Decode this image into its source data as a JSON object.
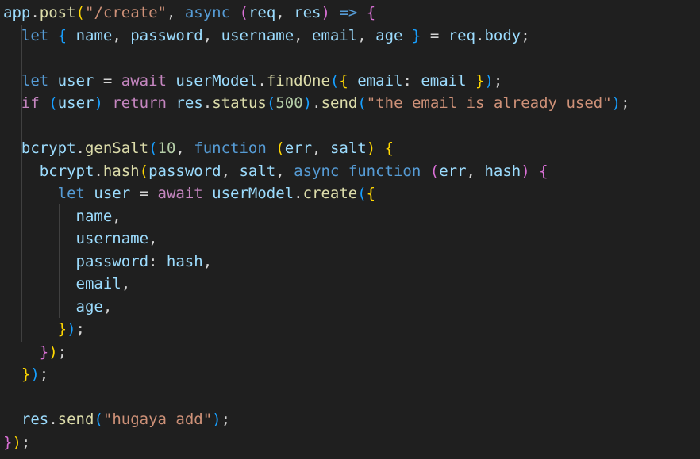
{
  "editor": {
    "theme": {
      "background": "#1f1f1f",
      "variable": "#9cdcfe",
      "function": "#dcdcaa",
      "string": "#ce9178",
      "keyword": "#569cd6",
      "control": "#c586c0",
      "number": "#b5cea8",
      "punctuation": "#d4d4d4",
      "bracket1": "#ffd700",
      "bracket2": "#da70d6",
      "bracket3": "#179fff"
    },
    "lines": [
      [
        [
          "var",
          "app"
        ],
        [
          "p",
          "."
        ],
        [
          "fn",
          "post"
        ],
        [
          "b1",
          "("
        ],
        [
          "str",
          "\"/create\""
        ],
        [
          "p",
          ", "
        ],
        [
          "kw",
          "async"
        ],
        [
          "p",
          " "
        ],
        [
          "b2",
          "("
        ],
        [
          "var",
          "req"
        ],
        [
          "p",
          ", "
        ],
        [
          "var",
          "res"
        ],
        [
          "b2",
          ")"
        ],
        [
          "p",
          " "
        ],
        [
          "kw",
          "=>"
        ],
        [
          "p",
          " "
        ],
        [
          "b2",
          "{"
        ]
      ],
      [
        [
          "p",
          "  "
        ],
        [
          "kw",
          "let"
        ],
        [
          "p",
          " "
        ],
        [
          "b3",
          "{"
        ],
        [
          "p",
          " "
        ],
        [
          "var",
          "name"
        ],
        [
          "p",
          ", "
        ],
        [
          "var",
          "password"
        ],
        [
          "p",
          ", "
        ],
        [
          "var",
          "username"
        ],
        [
          "p",
          ", "
        ],
        [
          "var",
          "email"
        ],
        [
          "p",
          ", "
        ],
        [
          "var",
          "age"
        ],
        [
          "p",
          " "
        ],
        [
          "b3",
          "}"
        ],
        [
          "p",
          " = "
        ],
        [
          "var",
          "req"
        ],
        [
          "p",
          "."
        ],
        [
          "var",
          "body"
        ],
        [
          "p",
          ";"
        ]
      ],
      [],
      [
        [
          "p",
          "  "
        ],
        [
          "kw",
          "let"
        ],
        [
          "p",
          " "
        ],
        [
          "var",
          "user"
        ],
        [
          "p",
          " = "
        ],
        [
          "ctrl",
          "await"
        ],
        [
          "p",
          " "
        ],
        [
          "var",
          "userModel"
        ],
        [
          "p",
          "."
        ],
        [
          "fn",
          "findOne"
        ],
        [
          "b3",
          "("
        ],
        [
          "b1",
          "{"
        ],
        [
          "p",
          " "
        ],
        [
          "var",
          "email"
        ],
        [
          "p",
          ": "
        ],
        [
          "var",
          "email"
        ],
        [
          "p",
          " "
        ],
        [
          "b1",
          "}"
        ],
        [
          "b3",
          ")"
        ],
        [
          "p",
          ";"
        ]
      ],
      [
        [
          "p",
          "  "
        ],
        [
          "ctrl",
          "if"
        ],
        [
          "p",
          " "
        ],
        [
          "b3",
          "("
        ],
        [
          "var",
          "user"
        ],
        [
          "b3",
          ")"
        ],
        [
          "p",
          " "
        ],
        [
          "ctrl",
          "return"
        ],
        [
          "p",
          " "
        ],
        [
          "var",
          "res"
        ],
        [
          "p",
          "."
        ],
        [
          "fn",
          "status"
        ],
        [
          "b3",
          "("
        ],
        [
          "num",
          "500"
        ],
        [
          "b3",
          ")"
        ],
        [
          "p",
          "."
        ],
        [
          "fn",
          "send"
        ],
        [
          "b3",
          "("
        ],
        [
          "str",
          "\"the email is already used\""
        ],
        [
          "b3",
          ")"
        ],
        [
          "p",
          ";"
        ]
      ],
      [],
      [
        [
          "p",
          "  "
        ],
        [
          "var",
          "bcrypt"
        ],
        [
          "p",
          "."
        ],
        [
          "fn",
          "genSalt"
        ],
        [
          "b3",
          "("
        ],
        [
          "num",
          "10"
        ],
        [
          "p",
          ", "
        ],
        [
          "kw",
          "function"
        ],
        [
          "p",
          " "
        ],
        [
          "b1",
          "("
        ],
        [
          "var",
          "err"
        ],
        [
          "p",
          ", "
        ],
        [
          "var",
          "salt"
        ],
        [
          "b1",
          ")"
        ],
        [
          "p",
          " "
        ],
        [
          "b1",
          "{"
        ]
      ],
      [
        [
          "p",
          "    "
        ],
        [
          "var",
          "bcrypt"
        ],
        [
          "p",
          "."
        ],
        [
          "fn",
          "hash"
        ],
        [
          "b1",
          "("
        ],
        [
          "var",
          "password"
        ],
        [
          "p",
          ", "
        ],
        [
          "var",
          "salt"
        ],
        [
          "p",
          ", "
        ],
        [
          "kw",
          "async"
        ],
        [
          "p",
          " "
        ],
        [
          "kw",
          "function"
        ],
        [
          "p",
          " "
        ],
        [
          "b2",
          "("
        ],
        [
          "var",
          "err"
        ],
        [
          "p",
          ", "
        ],
        [
          "var",
          "hash"
        ],
        [
          "b2",
          ")"
        ],
        [
          "p",
          " "
        ],
        [
          "b2",
          "{"
        ]
      ],
      [
        [
          "p",
          "      "
        ],
        [
          "kw",
          "let"
        ],
        [
          "p",
          " "
        ],
        [
          "var",
          "user"
        ],
        [
          "p",
          " = "
        ],
        [
          "ctrl",
          "await"
        ],
        [
          "p",
          " "
        ],
        [
          "var",
          "userModel"
        ],
        [
          "p",
          "."
        ],
        [
          "fn",
          "create"
        ],
        [
          "b3",
          "("
        ],
        [
          "b1",
          "{"
        ]
      ],
      [
        [
          "p",
          "        "
        ],
        [
          "var",
          "name"
        ],
        [
          "p",
          ","
        ]
      ],
      [
        [
          "p",
          "        "
        ],
        [
          "var",
          "username"
        ],
        [
          "p",
          ","
        ]
      ],
      [
        [
          "p",
          "        "
        ],
        [
          "var",
          "password"
        ],
        [
          "p",
          ": "
        ],
        [
          "var",
          "hash"
        ],
        [
          "p",
          ","
        ]
      ],
      [
        [
          "p",
          "        "
        ],
        [
          "var",
          "email"
        ],
        [
          "p",
          ","
        ]
      ],
      [
        [
          "p",
          "        "
        ],
        [
          "var",
          "age"
        ],
        [
          "p",
          ","
        ]
      ],
      [
        [
          "p",
          "      "
        ],
        [
          "b1",
          "}"
        ],
        [
          "b3",
          ")"
        ],
        [
          "p",
          ";"
        ]
      ],
      [
        [
          "p",
          "    "
        ],
        [
          "b2",
          "}"
        ],
        [
          "b1",
          ")"
        ],
        [
          "p",
          ";"
        ]
      ],
      [
        [
          "p",
          "  "
        ],
        [
          "b1",
          "}"
        ],
        [
          "b3",
          ")"
        ],
        [
          "p",
          ";"
        ]
      ],
      [],
      [
        [
          "p",
          "  "
        ],
        [
          "var",
          "res"
        ],
        [
          "p",
          "."
        ],
        [
          "fn",
          "send"
        ],
        [
          "b3",
          "("
        ],
        [
          "str",
          "\"hugaya add\""
        ],
        [
          "b3",
          ")"
        ],
        [
          "p",
          ";"
        ]
      ],
      [
        [
          "b2",
          "}"
        ],
        [
          "b1",
          ")"
        ],
        [
          "p",
          ";"
        ]
      ]
    ]
  }
}
